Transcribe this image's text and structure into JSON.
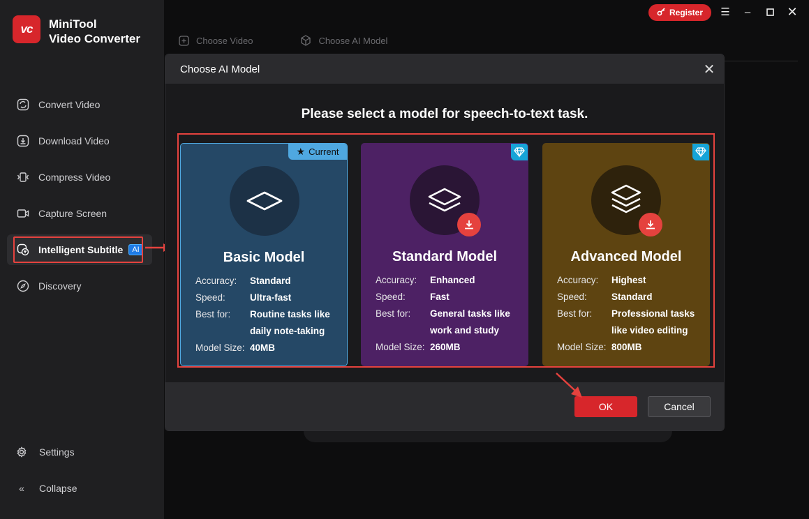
{
  "app": {
    "logo_text": "vc",
    "name_line1": "MiniTool",
    "name_line2": "Video Converter"
  },
  "sidebar": {
    "items": [
      {
        "label": "Convert Video",
        "icon": "convert-icon"
      },
      {
        "label": "Download Video",
        "icon": "download-icon"
      },
      {
        "label": "Compress Video",
        "icon": "compress-icon"
      },
      {
        "label": "Capture Screen",
        "icon": "camera-icon"
      },
      {
        "label": "Intelligent Subtitle",
        "icon": "subtitle-icon",
        "badge": "AI",
        "active": true
      },
      {
        "label": "Discovery",
        "icon": "compass-icon"
      }
    ],
    "settings_label": "Settings",
    "collapse_label": "Collapse"
  },
  "topbar": {
    "register_label": "Register"
  },
  "background_tabs": {
    "choose_video": "Choose Video",
    "choose_ai_model": "Choose AI Model"
  },
  "dialog": {
    "title": "Choose AI Model",
    "prompt": "Please select a model for speech-to-text task.",
    "labels": {
      "accuracy": "Accuracy:",
      "speed": "Speed:",
      "best_for": "Best for:",
      "model_size": "Model Size:"
    },
    "current_tag": "Current",
    "models": [
      {
        "name": "Basic Model",
        "accuracy": "Standard",
        "speed": "Ultra-fast",
        "best_for_1": "Routine tasks like",
        "best_for_2": "daily note-taking",
        "size": "40MB"
      },
      {
        "name": "Standard Model",
        "accuracy": "Enhanced",
        "speed": "Fast",
        "best_for_1": "General tasks like",
        "best_for_2": "work and study",
        "size": "260MB"
      },
      {
        "name": "Advanced Model",
        "accuracy": "Highest",
        "speed": "Standard",
        "best_for_1": "Professional tasks",
        "best_for_2": "like video editing",
        "size": "800MB"
      }
    ],
    "ok_label": "OK",
    "cancel_label": "Cancel"
  },
  "colors": {
    "accent": "#d7262b",
    "highlight": "#e5423e",
    "basic": "#254866",
    "standard": "#4d2164",
    "advanced": "#5e4411"
  }
}
